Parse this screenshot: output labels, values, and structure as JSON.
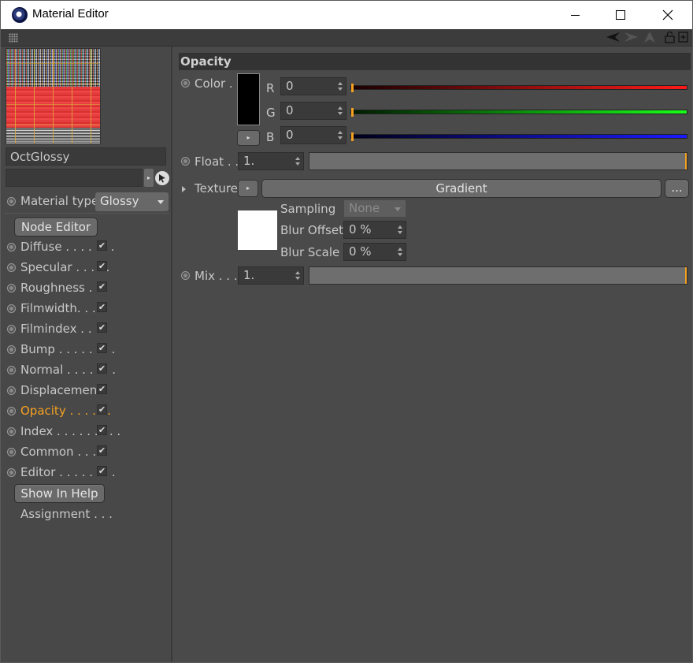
{
  "window": {
    "title": "Material Editor"
  },
  "material": {
    "name": "OctGlossy",
    "layer_value": "",
    "type_label": "Material type",
    "type_value": "Glossy"
  },
  "sidebar": {
    "node_editor_label": "Node Editor",
    "show_help_label": "Show In Help",
    "assignment_label": "Assignment . . .",
    "channels": [
      {
        "label": "Diffuse . . . . . . ."
      },
      {
        "label": "Specular . . . . ."
      },
      {
        "label": "Roughness . ."
      },
      {
        "label": "Filmwidth. . . ."
      },
      {
        "label": "Filmindex . . . ."
      },
      {
        "label": "Bump . . . . . . . ."
      },
      {
        "label": "Normal . . . . . . ."
      },
      {
        "label": "Displacement"
      },
      {
        "label": "Opacity . . . . . ."
      },
      {
        "label": "Index . . . . . . . . ."
      },
      {
        "label": "Common . . . ."
      },
      {
        "label": "Editor . . . . . . . ."
      }
    ],
    "active_channel": "Opacity",
    "checkmark": "✔"
  },
  "section": {
    "title": "Opacity"
  },
  "color": {
    "label": "Color . .",
    "swatch": "#000000",
    "r_label": "R",
    "r_value": "0",
    "g_label": "G",
    "g_value": "0",
    "b_label": "B",
    "b_value": "0"
  },
  "float": {
    "label": "Float . .",
    "value": "1."
  },
  "texture": {
    "label": "Texture",
    "button_label": "Gradient",
    "more_label": "...",
    "sampling_label": "Sampling",
    "sampling_value": "None",
    "blur_offset_label": "Blur Offset",
    "blur_offset_value": "0 %",
    "blur_scale_label": "Blur Scale",
    "blur_scale_value": "0 %"
  },
  "mix": {
    "label": "Mix . . . .",
    "value": "1."
  },
  "colors": {
    "accent": "#f4a020",
    "panel": "#4a4a4a"
  }
}
